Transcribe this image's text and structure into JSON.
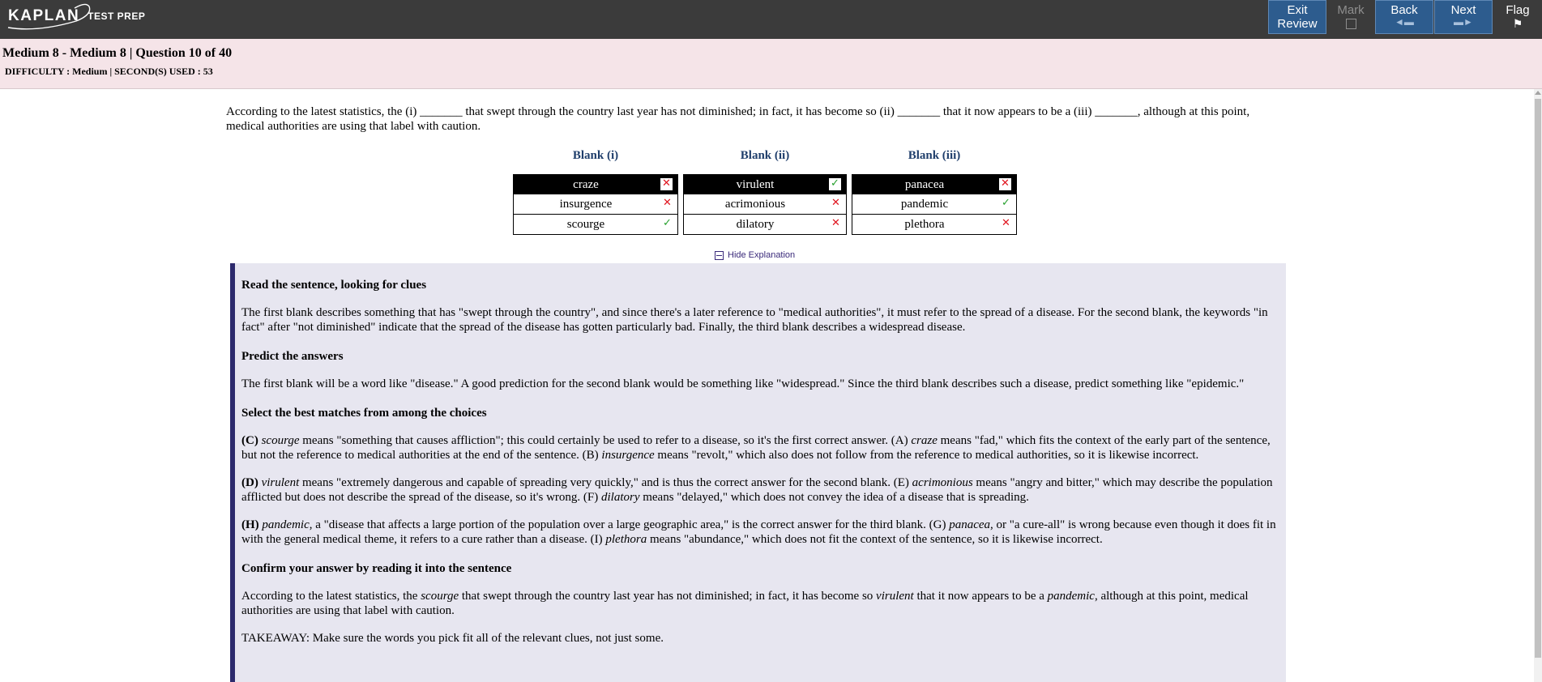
{
  "brand": {
    "name": "KAPLAN",
    "sub": "TEST PREP"
  },
  "nav": {
    "exit_review": "Exit\nReview",
    "mark": "Mark",
    "back": "Back",
    "next": "Next",
    "flag": "Flag",
    "flag_icon": "flag-icon"
  },
  "question": {
    "title": "Medium 8 - Medium 8 | Question 10 of 40",
    "info": "DIFFICULTY : Medium | SECOND(S) USED : 53",
    "stem": "According to the latest statistics, the (i) _______ that swept through the country last year has not diminished; in fact, it has become so (ii) _______ that it now appears to be a (iii) _______, although at this point, medical authorities are using that label with caution."
  },
  "blanks": [
    {
      "header": "Blank (i)",
      "choices": [
        {
          "text": "craze",
          "mark": "✕",
          "selected": true
        },
        {
          "text": "insurgence",
          "mark": "✕"
        },
        {
          "text": "scourge",
          "mark": "✓"
        }
      ]
    },
    {
      "header": "Blank (ii)",
      "choices": [
        {
          "text": "virulent",
          "mark": "✓",
          "selected": true
        },
        {
          "text": "acrimonious",
          "mark": "✕"
        },
        {
          "text": "dilatory",
          "mark": "✕"
        }
      ]
    },
    {
      "header": "Blank (iii)",
      "choices": [
        {
          "text": "panacea",
          "mark": "✕",
          "selected": true
        },
        {
          "text": "pandemic",
          "mark": "✓"
        },
        {
          "text": "plethora",
          "mark": "✕"
        }
      ]
    }
  ],
  "hide_explanation": "Hide Explanation",
  "explanation": {
    "h1": "Read the sentence, looking for clues",
    "p1": "The first blank describes something that has \"swept through the country\", and since there's a later reference to \"medical authorities\", it must refer to the spread of a disease. For the second blank, the keywords \"in fact\" after \"not diminished\" indicate that the spread of the disease has gotten particularly bad. Finally, the third blank describes a widespread disease.",
    "h2": "Predict the answers",
    "p2": "The first blank will be a word like \"disease.\" A good prediction for the second blank would be something like \"widespread.\" Since the third blank describes such a disease, predict something like \"epidemic.\"",
    "h3": "Select the best matches from among the choices",
    "pc": {
      "lead": "(C)",
      "w1": "scourge",
      "t1": " means \"something that causes affliction\"; this could certainly be used to refer to a disease, so it's the first correct answer. (A) ",
      "w2": "craze",
      "t2": " means \"fad,\" which fits the context of the early part of the sentence, but not the reference to medical authorities at the end of the sentence. (B) ",
      "w3": "insurgence",
      "t3": " means \"revolt,\" which also does not follow from the reference to medical authorities, so it is likewise incorrect."
    },
    "pd": {
      "lead": "(D)",
      "w1": "virulent",
      "t1": " means \"extremely dangerous and capable of spreading very quickly,\" and is thus the correct answer for the second blank. (E) ",
      "w2": "acrimonious",
      "t2": " means \"angry and bitter,\" which may describe the population afflicted but does not describe the spread of the disease, so it's wrong. (F) ",
      "w3": "dilatory",
      "t3": " means \"delayed,\" which does not convey the idea of a disease that is spreading."
    },
    "ph": {
      "lead": "(H)",
      "w1": "pandemic",
      "t1": ", a \"disease that affects a large portion of the population over a large geographic area,\" is the correct answer for the third blank. (G) ",
      "w2": "panacea",
      "t2": ", or \"a cure-all\" is wrong because even though it does fit in with the general medical theme, it refers to a cure rather than a disease. (I) ",
      "w3": "plethora",
      "t3": " means \"abundance,\" which does not fit the context of the sentence, so it is likewise incorrect."
    },
    "h4": "Confirm your answer by reading it into the sentence",
    "pf": {
      "t0": "According to the latest statistics, the ",
      "w1": "scourge",
      "t1": " that swept through the country last year has not diminished; in fact, it has become so ",
      "w2": "virulent",
      "t2": " that it now appears to be a ",
      "w3": "pandemic",
      "t3": ", although at this point, medical authorities are using that label with caution."
    },
    "takeaway": "TAKEAWAY: Make sure the words you pick fit all of the relevant clues, not just some."
  }
}
